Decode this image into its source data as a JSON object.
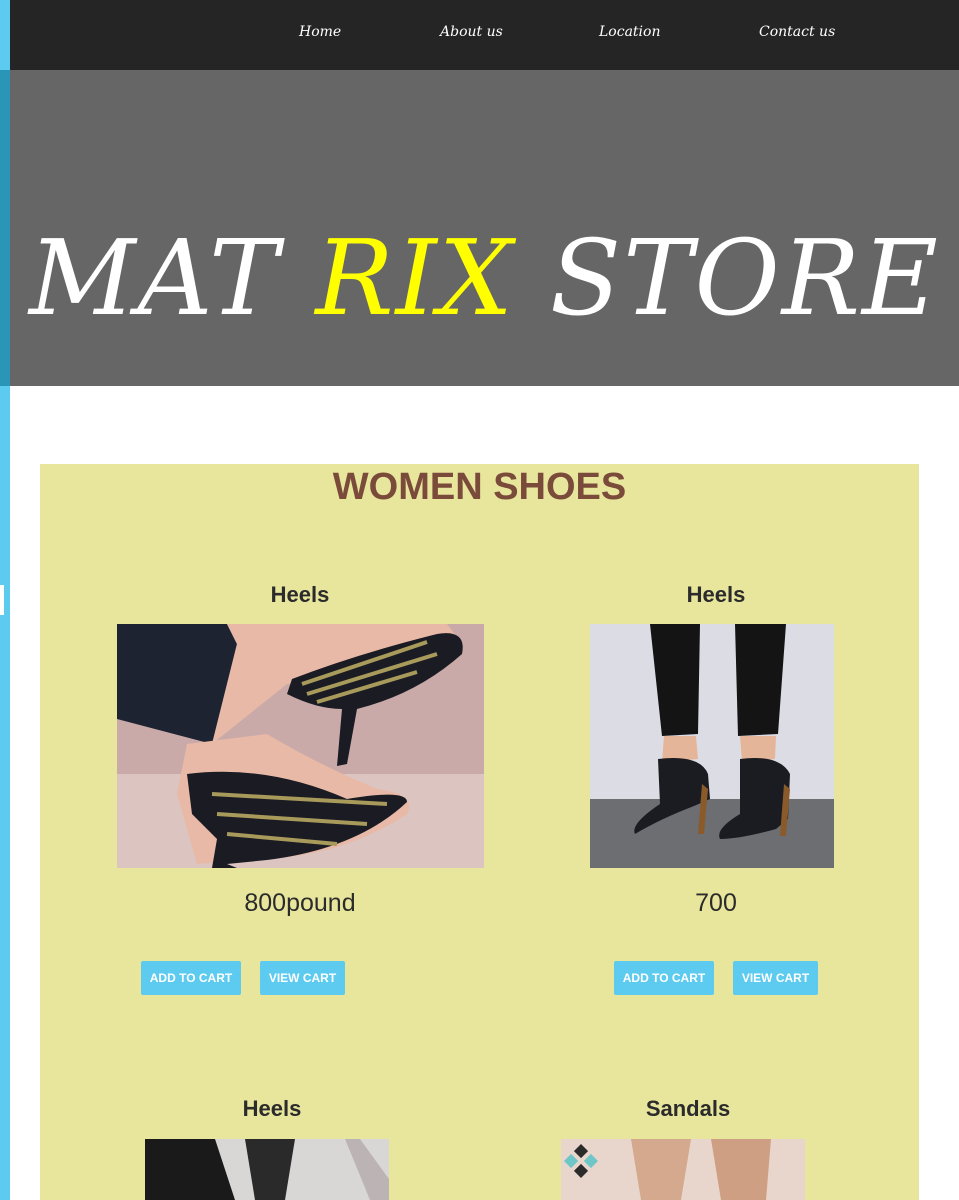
{
  "nav": {
    "items": [
      "Home",
      "About us",
      "Location",
      "Contact us"
    ]
  },
  "hero": {
    "title_part1": "MAT ",
    "title_highlight": "RIX",
    "title_part2": " STORE"
  },
  "section": {
    "title": "WOMEN SHOES"
  },
  "products": [
    {
      "title": "Heels",
      "price": "800pound",
      "add_label": "ADD TO CART",
      "view_label": "VIEW CART"
    },
    {
      "title": "Heels",
      "price": "700",
      "add_label": "ADD TO CART",
      "view_label": "VIEW CART"
    },
    {
      "title": "Heels"
    },
    {
      "title": "Sandals"
    }
  ],
  "colors": {
    "nav_bg": "#252525",
    "hero_bg": "#666666",
    "highlight": "#ffff00",
    "section_bg": "#e8e69c",
    "button": "#5ccbef",
    "section_title": "#7a4b3a"
  }
}
